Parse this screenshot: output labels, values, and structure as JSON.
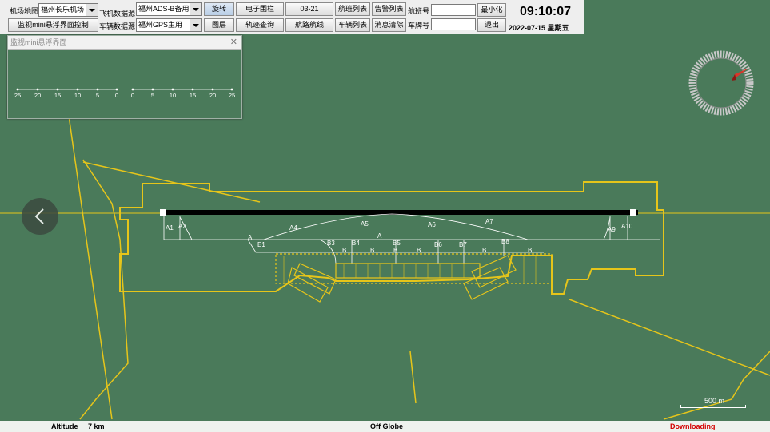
{
  "toolbar": {
    "airport_map_label": "机场地图",
    "airport_select": "福州长乐机场",
    "aircraft_source_label": "飞机数据源",
    "aircraft_source_select": "福州ADS-B备用",
    "vehicle_source_label": "车辆数据源",
    "vehicle_source_select": "福州GPS主用",
    "mini_control_button": "监视mini悬浮界面控制",
    "rotate_button": "旋转",
    "layers_button": "图层",
    "efence_button": "电子围栏",
    "track_query_button": "轨迹查询",
    "runway_button": "03-21",
    "route_button": "航路航线",
    "flight_list_button": "航班列表",
    "vehicle_list_button": "车辆列表",
    "alarm_list_button": "告警列表",
    "clear_msg_button": "消息清除",
    "flight_no_label": "航班号",
    "plate_no_label": "车牌号",
    "minimize_button": "最小化",
    "exit_button": "退出"
  },
  "clock": {
    "time": "09:10:07",
    "date": "2022-07-15  星期五"
  },
  "mini_window": {
    "title": "监视mini悬浮界面",
    "scale_left": [
      "25",
      "20",
      "15",
      "10",
      "5",
      "0"
    ],
    "scale_right": [
      "0",
      "5",
      "10",
      "15",
      "20",
      "25"
    ]
  },
  "map": {
    "taxi_labels": [
      "A1",
      "A2",
      "A4",
      "A5",
      "A6",
      "A7",
      "A9",
      "A10",
      "A",
      "A",
      "E1",
      "B3",
      "B4",
      "B5",
      "B6",
      "B7",
      "B8",
      "B",
      "B",
      "B",
      "B",
      "B",
      "B"
    ],
    "scale_label": "500 m",
    "colors": {
      "background": "#4a7a5a",
      "boundary": "#e6c51a",
      "runway": "#000000",
      "taxi": "#ffffff"
    }
  },
  "status": {
    "altitude_label": "Altitude",
    "altitude_value": "7 km",
    "globe": "Off Globe",
    "downloading": "Downloading"
  }
}
